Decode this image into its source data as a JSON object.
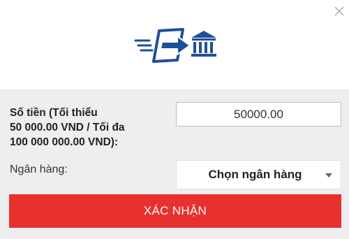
{
  "dialog": {
    "close_icon": "close-icon",
    "hero_icon": "transfer-to-bank-icon"
  },
  "form": {
    "amount_label_line1": "Số tiền (Tối thiểu",
    "amount_label_line2": "50 000.00 VND / Tối đa",
    "amount_label_line3": "100 000 000.00 VND):",
    "amount_value": "50000.00",
    "bank_label": "Ngân hàng:",
    "bank_select_value": "Chọn ngân hàng",
    "confirm_label": "XÁC NHẬN"
  },
  "colors": {
    "accent": "#e8312f",
    "icon_blue": "#1f4e9a",
    "panel_bg": "#eeeeee"
  }
}
